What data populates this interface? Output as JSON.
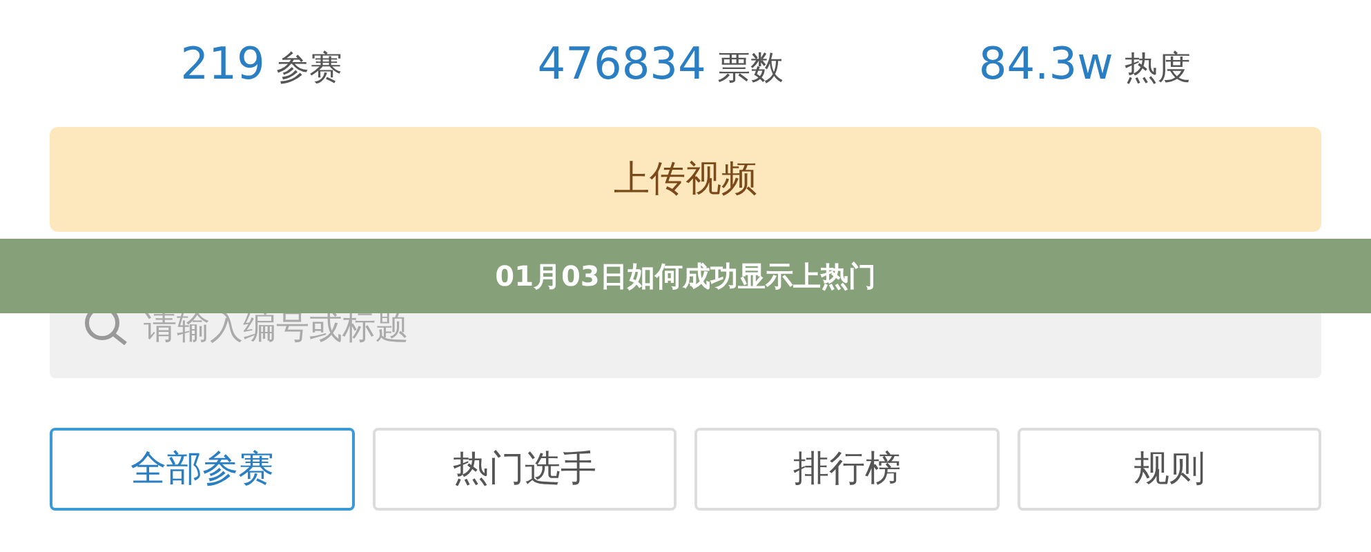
{
  "stats": [
    {
      "value": "219",
      "label": "参赛"
    },
    {
      "value": "476834",
      "label": "票数"
    },
    {
      "value": "84.3w",
      "label": "热度"
    }
  ],
  "upload_button": "上传视频",
  "search": {
    "placeholder": "请输入编号或标题"
  },
  "tabs": [
    {
      "label": "全部参赛",
      "selected": true
    },
    {
      "label": "热门选手",
      "selected": false
    },
    {
      "label": "排行榜",
      "selected": false
    },
    {
      "label": "规则",
      "selected": false
    }
  ],
  "banner": {
    "title": "01月03日如何成功显示上热门"
  }
}
